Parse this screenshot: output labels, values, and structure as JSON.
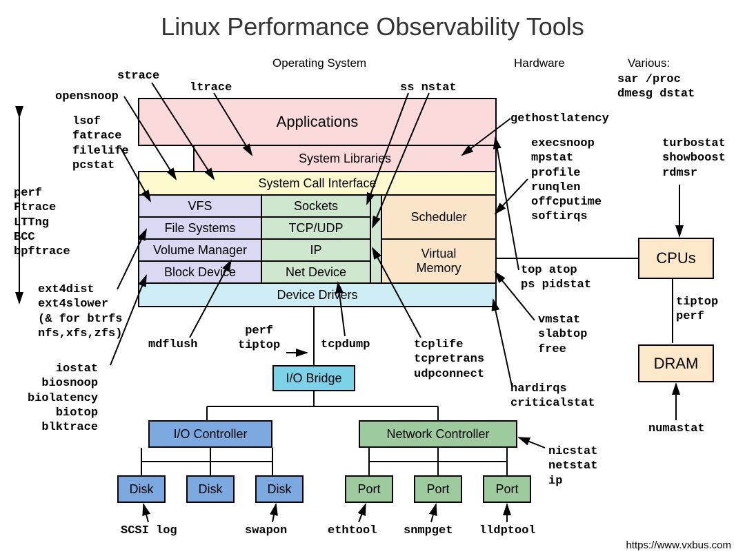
{
  "title": "Linux Performance Observability Tools",
  "sections": {
    "os": "Operating System",
    "hw": "Hardware",
    "various": "Various:"
  },
  "boxes": {
    "applications": "Applications",
    "syslibs": "System Libraries",
    "syscall": "System Call Interface",
    "vfs": "VFS",
    "sockets": "Sockets",
    "fs": "File Systems",
    "tcpudp": "TCP/UDP",
    "volmgr": "Volume Manager",
    "ip": "IP",
    "blockdev": "Block Device",
    "netdev": "Net Device",
    "scheduler": "Scheduler",
    "vmem": "Virtual\nMemory",
    "drivers": "Device Drivers",
    "iobridge": "I/O Bridge",
    "ioctrl": "I/O Controller",
    "netctrl": "Network Controller",
    "disk": "Disk",
    "port": "Port",
    "cpus": "CPUs",
    "dram": "DRAM"
  },
  "tools": {
    "strace": "strace",
    "ltrace": "ltrace",
    "ssnstat": "ss nstat",
    "opensnoop": "opensnoop",
    "lsof_group": "lsof\nfatrace\nfilelife\npcstat",
    "tracers": "perf\nFtrace\nLTTng\nBCC\nbpftrace",
    "ext4": "ext4dist\next4slower\n(& for btrfs\nnfs,xfs,zfs)",
    "iostat_group": "iostat\nbiosnoop\nbiolatency\nbiotop\nblktrace",
    "mdflush": "mdflush",
    "perftiptop": "perf\ntiptop",
    "tcpdump": "tcpdump",
    "tcplife": "tcplife\ntcpretrans\nudpconnect",
    "gethostlatency": "gethostlatency",
    "sched_tools": "execsnoop\nmpstat\nprofile\nrunqlen\noffcputime\nsoftirqs",
    "top_group": "top atop\nps pidstat",
    "vmstat_group": "vmstat\nslabtop\nfree",
    "hardirqs": "hardirqs\ncriticalstat",
    "various_tools": "sar /proc\ndmesg dstat",
    "turbostat": "turbostat\nshowboost\nrdmsr",
    "tiptopperf": "tiptop\nperf",
    "numastat": "numastat",
    "nicstat": "nicstat\nnetstat\nip",
    "scsilog": "SCSI log",
    "swapon": "swapon",
    "ethtool": "ethtool",
    "snmpget": "snmpget",
    "lldptool": "lldptool"
  },
  "footer": "https://www.vxbus.com"
}
